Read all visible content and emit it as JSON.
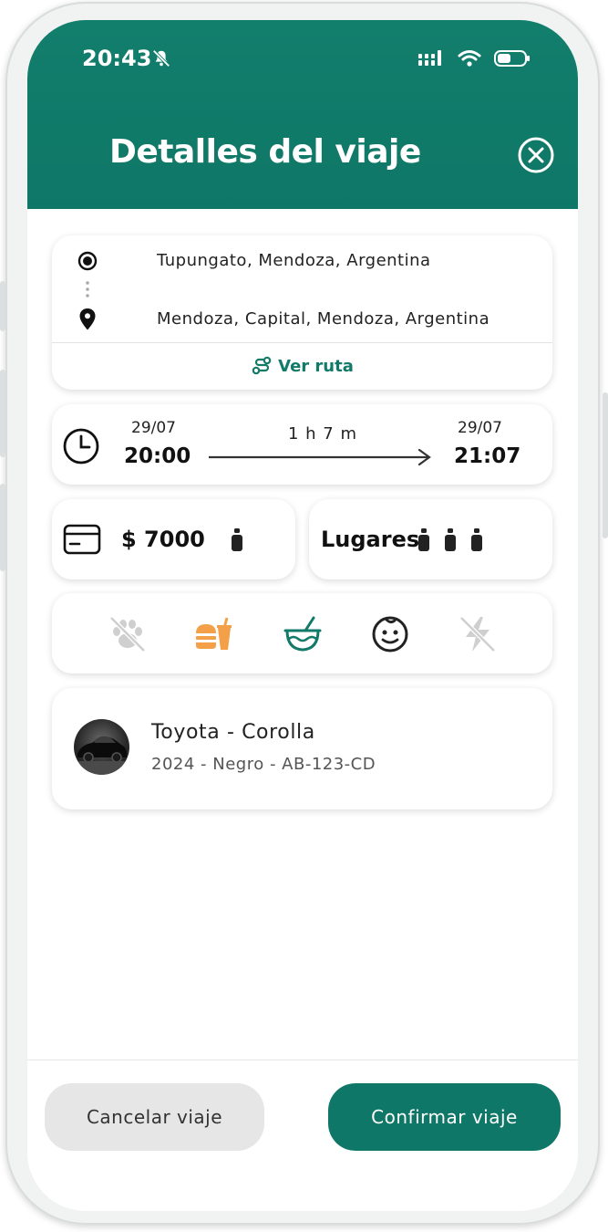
{
  "status_bar": {
    "time": "20:43",
    "icons": [
      "bell-off-icon",
      "signal-icon",
      "wifi-icon",
      "battery-icon"
    ]
  },
  "header": {
    "title": "Detalles del viaje",
    "close_icon": "close-circle-icon"
  },
  "route": {
    "origin": "Tupungato, Mendoza, Argentina",
    "destination": "Mendoza, Capital, Mendoza, Argentina",
    "view_route_label": "Ver ruta"
  },
  "schedule": {
    "departure_date": "29/07",
    "departure_time": "20:00",
    "duration": "1 h 7 m",
    "arrival_date": "29/07",
    "arrival_time": "21:07"
  },
  "price": {
    "label": "$ 7000",
    "icon": "credit-card-icon"
  },
  "seats": {
    "label": "Lugares",
    "available": 3
  },
  "amenities": [
    {
      "name": "pets",
      "icon": "paw-off-icon",
      "enabled": false,
      "color": "#cfcfcf"
    },
    {
      "name": "food",
      "icon": "food-icon",
      "enabled": true,
      "color": "#f3a049"
    },
    {
      "name": "mate",
      "icon": "mate-icon",
      "enabled": true,
      "color": "#127a68"
    },
    {
      "name": "baby",
      "icon": "baby-face-icon",
      "enabled": true,
      "color": "#222222"
    },
    {
      "name": "charging",
      "icon": "bolt-off-icon",
      "enabled": false,
      "color": "#cfcfcf"
    }
  ],
  "vehicle": {
    "title": "Toyota - Corolla",
    "details": "2024 - Negro - AB-123-CD"
  },
  "actions": {
    "cancel_label": "Cancelar viaje",
    "confirm_label": "Confirmar viaje"
  },
  "colors": {
    "primary": "#0f7767",
    "accent_orange": "#f3a049",
    "disabled": "#cfcfcf"
  }
}
